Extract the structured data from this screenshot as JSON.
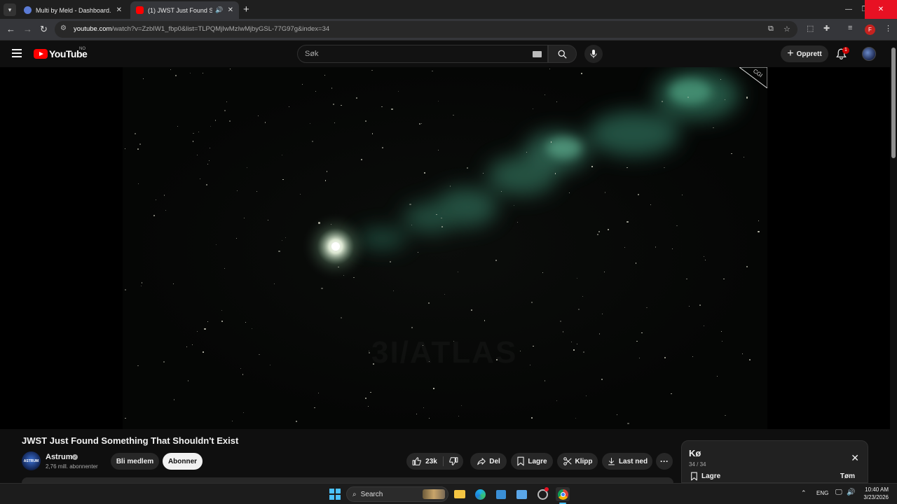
{
  "browser": {
    "tabs": [
      {
        "title": "Multi by Meld - Dashboard.",
        "active": false
      },
      {
        "title": "(1) JWST Just Found Something That Shouldn't Exist",
        "active": true
      }
    ],
    "url_host": "youtube.com",
    "url_path": "/watch?v=ZzbIW1_fbp0&list=TLPQMjIwMzIwMjbyGSL-77G97g&index=34",
    "profile_initial": "F"
  },
  "youtube": {
    "logo_text": "YouTube",
    "region": "NO",
    "search_placeholder": "Søk",
    "create_label": "Opprett",
    "notification_count": "1"
  },
  "player": {
    "overlay_label": "CGI",
    "watermark": "3I/ATLAS"
  },
  "video": {
    "title": "JWST Just Found Something That Shouldn't Exist",
    "channel_name": "Astrum",
    "channel_avatar_text": "ASTRUM",
    "subscribers": "2,76 mill. abonnenter",
    "join_label": "Bli medlem",
    "subscribe_label": "Abonner",
    "likes": "23k",
    "share_label": "Del",
    "save_label": "Lagre",
    "clip_label": "Klipp",
    "download_label": "Last ned"
  },
  "queue": {
    "title": "Kø",
    "count": "34 / 34",
    "save_label": "Lagre",
    "clear_label": "Tøm"
  },
  "taskbar": {
    "search_label": "Search",
    "language": "ENG",
    "time": "10:40 AM",
    "date": "3/23/2026"
  },
  "colors": {
    "brand_red": "#ff0000",
    "close_red": "#e81123",
    "accent_blue": "#4cc2ff",
    "comet_tail": "#5fbf9a"
  }
}
